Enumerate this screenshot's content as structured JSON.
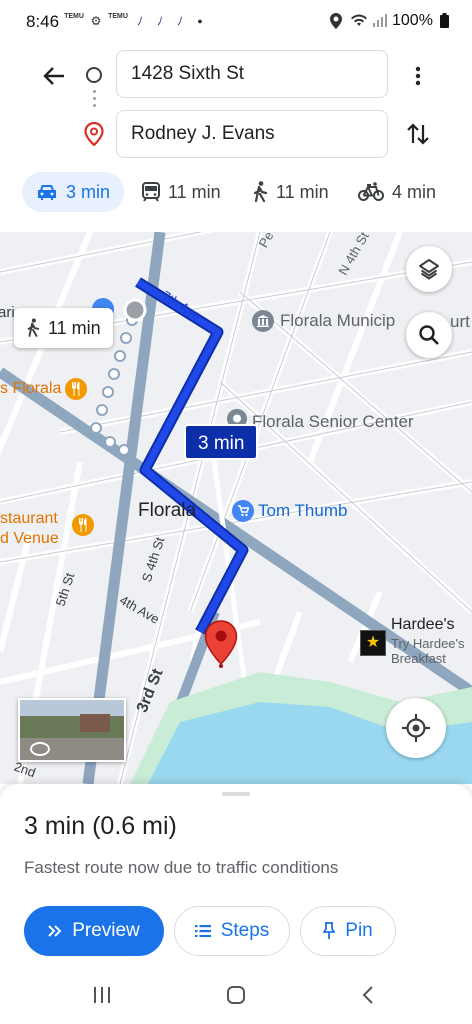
{
  "status_bar": {
    "time": "8:46",
    "app_badge_text": "TEMU",
    "battery": "100%"
  },
  "directions": {
    "origin": "1428 Sixth St",
    "destination": "Rodney J. Evans",
    "modes": [
      {
        "icon": "car-icon",
        "label": "3 min",
        "active": true
      },
      {
        "icon": "transit-icon",
        "label": "11 min"
      },
      {
        "icon": "walk-icon",
        "label": "11 min"
      },
      {
        "icon": "bike-icon",
        "label": "4 min"
      }
    ]
  },
  "map": {
    "route_badge": "3 min",
    "walk_badge": "11 min",
    "labels": {
      "seventh_ave": "7th Ave",
      "florala_municipal": "Florala Municip",
      "florala_municipal_tail": "urt",
      "florala_senior": "Florala Senior Center",
      "florala_restaurant": "s Florala",
      "restaurant_venue_1": "staurant",
      "restaurant_venue_2": "d Venue",
      "florala": "Florala",
      "tom_thumb": "Tom Thumb",
      "s_4th_st": "S 4th St",
      "n_4th_st": "N 4th St",
      "fifth_st": "5th St",
      "fourth_ave": "4th Ave",
      "third_st": "3rd St",
      "pe": "Pe",
      "ari": "ari",
      "hardees": "Hardee's",
      "try_hardees": "Try Hardee's",
      "breakfast": "Breakfast",
      "second": "2nd"
    },
    "accent_route": "#1a3fd6",
    "destination_pin": "#ea4335"
  },
  "summary": {
    "time": "3 min",
    "distance": "(0.6 mi)",
    "note": "Fastest route now due to traffic conditions",
    "preview_label": "Preview",
    "steps_label": "Steps",
    "pin_label": "Pin"
  }
}
